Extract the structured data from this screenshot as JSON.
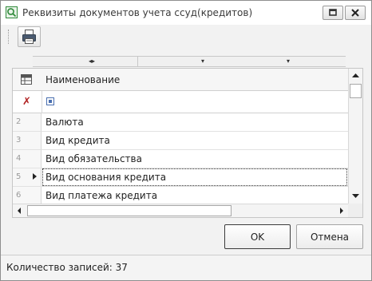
{
  "window": {
    "title": "Реквизиты документов учета ссуд(кредитов)"
  },
  "toolbar": {
    "print_icon": "printer-icon"
  },
  "grid": {
    "column_header": "Наименование",
    "rows": [
      {
        "num": "2",
        "name": "Валюта"
      },
      {
        "num": "3",
        "name": "Вид кредита"
      },
      {
        "num": "4",
        "name": "Вид обязательства"
      },
      {
        "num": "5",
        "name": "Вид основания кредита"
      },
      {
        "num": "6",
        "name": "Вид платежа кредита"
      }
    ],
    "selected_row": "5"
  },
  "buttons": {
    "ok": "OK",
    "cancel": "Отмена"
  },
  "status": {
    "text": "Количество записей: 37"
  }
}
